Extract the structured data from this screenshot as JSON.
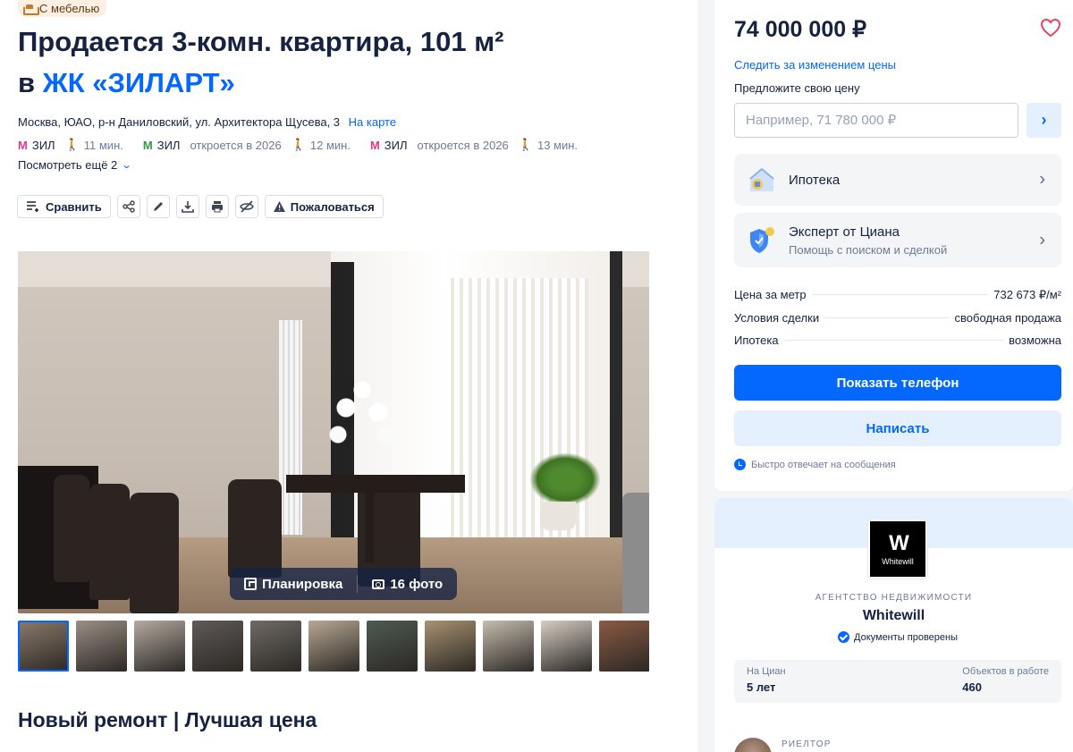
{
  "listing": {
    "furniture_badge": "С мебелью",
    "title_line1": "Продается 3-комн. квартира, 101 м²",
    "title_prefix": "в",
    "complex_link": "ЖК «ЗИЛАРТ»",
    "address": "Москва, ЮАО, р-н Даниловский, ул. Архитектора Щусева, 3",
    "map_link": "На карте",
    "metro": [
      {
        "name": "ЗИЛ",
        "color": "#e8378a",
        "note": "",
        "time": "11 мин."
      },
      {
        "name": "ЗИЛ",
        "color": "#2f9a44",
        "note": "откроется в 2026",
        "time": "12 мин."
      },
      {
        "name": "ЗИЛ",
        "color": "#e8378a",
        "note": "откроется в 2026",
        "time": "13 мин."
      }
    ],
    "see_more": "Посмотреть ещё 2"
  },
  "toolbar": {
    "compare": "Сравнить",
    "complain": "Пожаловаться",
    "icons": [
      "share-icon",
      "edit-icon",
      "download-icon",
      "print-icon",
      "hide-icon"
    ]
  },
  "gallery": {
    "layout_label": "Планировка",
    "photos_label": "16 фото",
    "thumbnails": [
      "#8a7b6c",
      "#9a8f86",
      "#b3aaa1",
      "#5f5a57",
      "#6f6a66",
      "#b8a896",
      "#4e5a53",
      "#a89272",
      "#c5bdb0",
      "#d6cec4",
      "#8a5a44"
    ]
  },
  "description_title": "Новый ремонт | Лучшая цена",
  "price_card": {
    "price": "74 000 000 ₽",
    "follow_price": "Следить за изменением цены",
    "offer_label": "Предложите свою цену",
    "offer_placeholder": "Например, 71 780 000 ₽",
    "mortgage": "Ипотека",
    "expert_title": "Эксперт от Циана",
    "expert_sub": "Помощь с поиском и сделкой",
    "facts": [
      {
        "label": "Цена за метр",
        "value": "732 673 ₽/м²"
      },
      {
        "label": "Условия сделки",
        "value": "свободная продажа"
      },
      {
        "label": "Ипотека",
        "value": "возможна"
      }
    ],
    "show_phone": "Показать телефон",
    "write": "Написать",
    "fast_reply": "Быстро отвечает на сообщения",
    "accent_color": "#0468ff",
    "heart_color": "#e84260"
  },
  "agency": {
    "logo_text": "Whitewill",
    "type": "АГЕНТСТВО НЕДВИЖИМОСТИ",
    "name": "Whitewill",
    "verified": "Документы проверены",
    "on_cian_label": "На Циан",
    "on_cian_value": "5 лет",
    "objects_label": "Объектов в работе",
    "objects_value": "460",
    "realtor_label": "РИЕЛТОР"
  }
}
